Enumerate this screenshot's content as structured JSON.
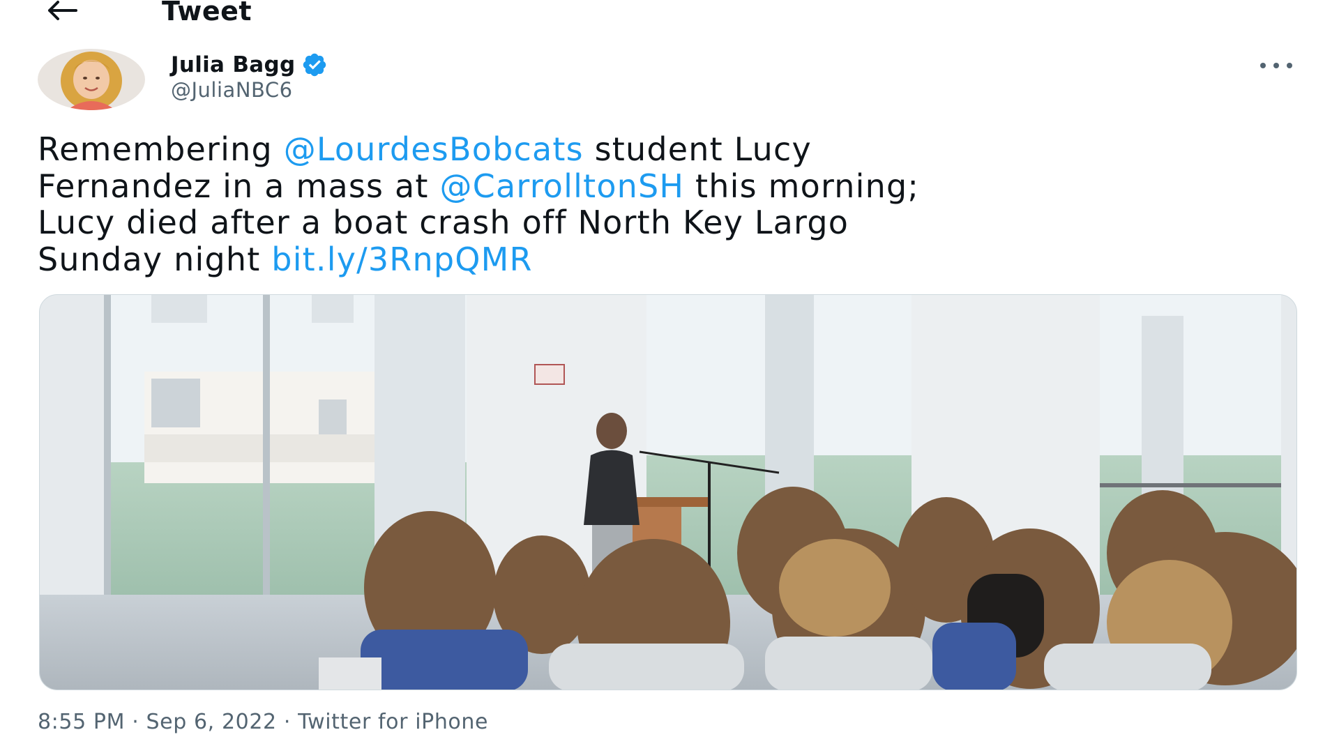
{
  "header": {
    "title": "Tweet",
    "back_icon": "arrow-left-icon"
  },
  "author": {
    "name": "Julia Bagg",
    "handle": "@JuliaNBC6",
    "verified": true,
    "verified_color": "#1d9bf0"
  },
  "tweet": {
    "lines": [
      [
        {
          "text": "Remembering ",
          "type": "text"
        },
        {
          "text": "@LourdesBobcats",
          "type": "mention"
        },
        {
          "text": " student Lucy",
          "type": "text"
        }
      ],
      [
        {
          "text": "Fernandez in a mass at ",
          "type": "text"
        },
        {
          "text": "@CarrolltonSH",
          "type": "mention"
        },
        {
          "text": " this morning;",
          "type": "text"
        }
      ],
      [
        {
          "text": "Lucy died after a boat crash off North Key Largo",
          "type": "text"
        }
      ],
      [
        {
          "text": "Sunday night ",
          "type": "text"
        },
        {
          "text": "bit.ly/3RnpQMR",
          "type": "link"
        }
      ]
    ]
  },
  "meta": {
    "time": "8:55 PM",
    "separator": "·",
    "date": "Sep 6, 2022",
    "source": "Twitter for iPhone"
  },
  "colors": {
    "link": "#1d9bf0",
    "text": "#0f1419",
    "secondary": "#536471"
  },
  "more_icon": "more-horizontal-icon"
}
